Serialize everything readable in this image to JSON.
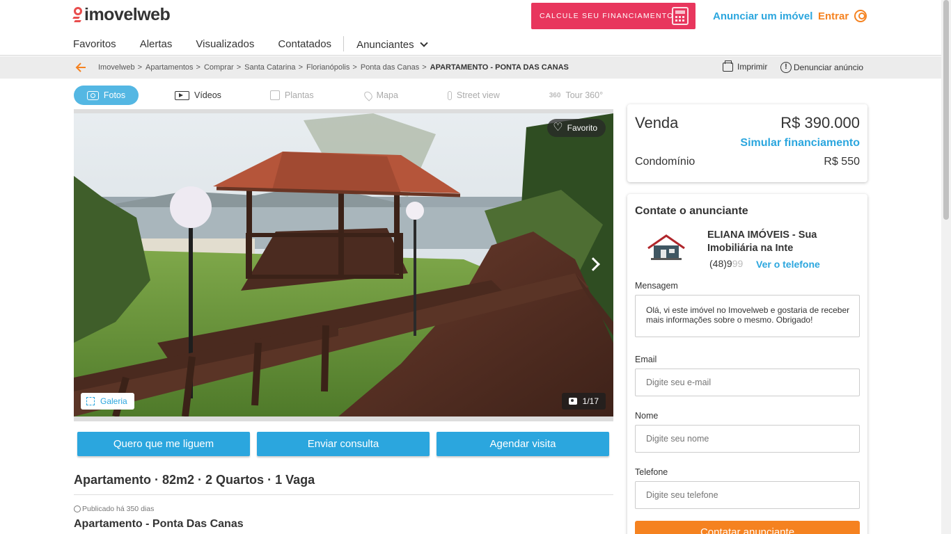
{
  "header": {
    "logo_text": "imovelweb",
    "financing_button": "CALCULE SEU FINANCIAMENTO",
    "anunciar": "Anunciar um imóvel",
    "entrar": "Entrar",
    "nav": [
      "Favoritos",
      "Alertas",
      "Visualizados",
      "Contatados",
      "Anunciantes"
    ]
  },
  "breadcrumb": {
    "items": [
      "Imovelweb",
      "Apartamentos",
      "Comprar",
      "Santa Catarina",
      "Florianópolis",
      "Ponta das Canas",
      "APARTAMENTO - PONTA DAS CANAS"
    ],
    "separator": ">",
    "print": "Imprimir",
    "report": "Denunciar anúncio"
  },
  "media_tabs": {
    "fotos": "Fotos",
    "videos": "Vídeos",
    "plantas": "Plantas",
    "mapa": "Mapa",
    "street_view": "Street view",
    "tour": "Tour 360°",
    "tour_icon_text": "360"
  },
  "gallery": {
    "favorite": "Favorito",
    "galeria": "Galeria",
    "counter": "1/17"
  },
  "actions": {
    "call_me": "Quero que me liguem",
    "send_inquiry": "Enviar consulta",
    "schedule_visit": "Agendar visita"
  },
  "listing": {
    "title": "Apartamento · 82m2 · 2 Quartos · 1 Vaga",
    "published": "Publicado há 350 dias",
    "subtitle": "Apartamento - Ponta Das Canas"
  },
  "price": {
    "operation": "Venda",
    "value": "R$ 390.000",
    "simulate": "Simular financiamento",
    "condo_label": "Condomínio",
    "condo_value": "R$ 550"
  },
  "contact": {
    "title": "Contate o anunciante",
    "agency_line1": "ELIANA IMÓVEIS - Sua",
    "agency_line2": "Imobiliária na Inte",
    "phone_visible": "(48)9",
    "phone_faded": "99",
    "see_phone": "Ver o telefone",
    "message_label": "Mensagem",
    "message": "Olá, vi este imóvel no Imovelweb e gostaria de receber mais informações sobre o mesmo. Obrigado!",
    "email_label": "Email",
    "email_placeholder": "Digite seu e-mail",
    "name_label": "Nome",
    "name_placeholder": "Digite seu nome",
    "phone_label": "Telefone",
    "phone_placeholder": "Digite seu telefone",
    "submit": "Contatar anunciante"
  },
  "colors": {
    "brand_blue": "#2ba6de",
    "brand_orange": "#f58220",
    "financing_red": "#e8365d",
    "logo_red": "#e84d4d"
  }
}
